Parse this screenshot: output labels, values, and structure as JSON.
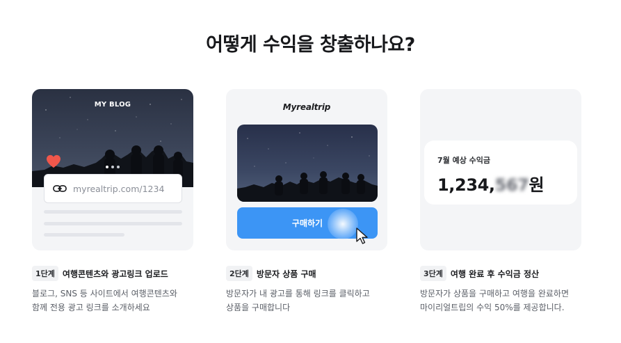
{
  "page": {
    "title": "어떻게 수익을 창출하나요?"
  },
  "cards": {
    "blog": {
      "label": "MY BLOG",
      "link_text": "myrealtrip.com/1234",
      "carousel_total": 3,
      "carousel_active": 1
    },
    "visit": {
      "brand": "Myrealtrip",
      "button_label": "구매하기"
    },
    "earnings": {
      "label": "7월 예상 수익금",
      "value_prefix": "1,234,",
      "value_blurred": "567",
      "value_suffix": "원"
    }
  },
  "steps": [
    {
      "badge": "1단계",
      "title": "여행콘텐츠와 광고링크 업로드",
      "desc_line1": "블로그, SNS 등 사이트에서 여행콘텐츠와",
      "desc_line2": "함께 전용 광고 링크를 소개하세요"
    },
    {
      "badge": "2단계",
      "title": "방문자 상품 구매",
      "desc_line1": "방문자가 내 광고를 통해 링크를 클릭하고",
      "desc_line2": "상품을 구매합니다"
    },
    {
      "badge": "3단계",
      "title": "여행 완료 후 수익금 정산",
      "desc_line1": "방문자가 상품을 구매하고 여행을 완료하면",
      "desc_line2": "마이리얼트립의 수익 50%를 제공합니다."
    }
  ],
  "colors": {
    "accent_blue": "#3c95f5",
    "heart_red": "#f0574b",
    "card_bg": "#f4f5f7",
    "title_text": "#17181b"
  },
  "icons": [
    "heart-icon",
    "link-icon",
    "cursor-icon"
  ]
}
